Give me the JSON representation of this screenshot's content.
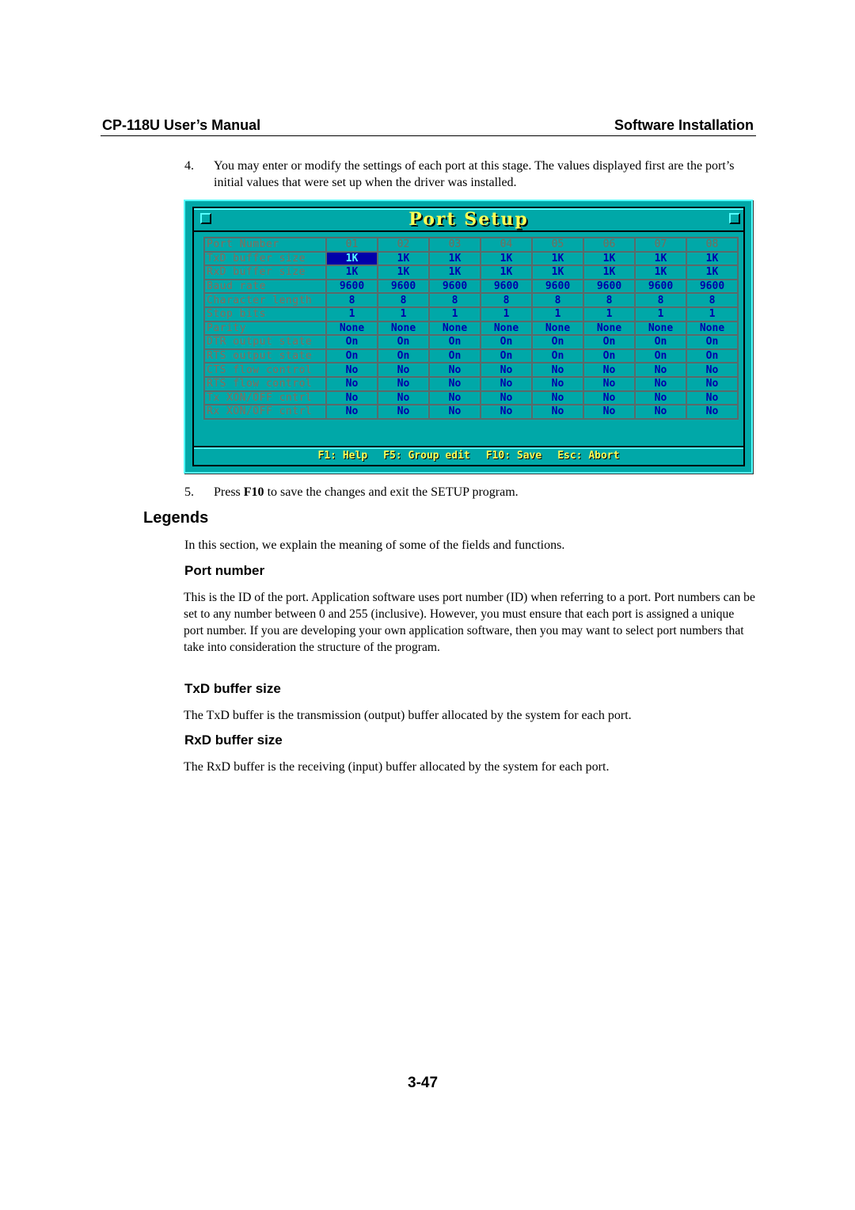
{
  "header": {
    "left": "CP-118U User’s Manual",
    "right": "Software Installation"
  },
  "steps": [
    {
      "num": "4.",
      "text": "You may enter or modify the settings of each port at this stage. The values displayed first are the port’s initial values that were set up when the driver was installed."
    },
    {
      "num": "5.",
      "pre": "Press ",
      "bold": "F10",
      "post": " to save the changes and exit the SETUP program."
    }
  ],
  "dos_window": {
    "title": "Port Setup",
    "colors": {
      "background": "#00a8a8",
      "highlight": "#55ffff",
      "title": "#ffff55",
      "value": "#0000aa",
      "label": "#8a6a5a",
      "selected_bg": "#0000aa"
    },
    "columns_label": "Port Number",
    "ports": [
      "01",
      "02",
      "03",
      "04",
      "05",
      "06",
      "07",
      "08"
    ],
    "selected_cell": {
      "row": "TxD buffer size",
      "port": "01"
    },
    "rows": [
      {
        "label": "TxD buffer size",
        "values": [
          "1K",
          "1K",
          "1K",
          "1K",
          "1K",
          "1K",
          "1K",
          "1K"
        ]
      },
      {
        "label": "RxD buffer size",
        "values": [
          "1K",
          "1K",
          "1K",
          "1K",
          "1K",
          "1K",
          "1K",
          "1K"
        ]
      },
      {
        "label": "Baud rate",
        "values": [
          "9600",
          "9600",
          "9600",
          "9600",
          "9600",
          "9600",
          "9600",
          "9600"
        ]
      },
      {
        "label": "Character length",
        "values": [
          "8",
          "8",
          "8",
          "8",
          "8",
          "8",
          "8",
          "8"
        ]
      },
      {
        "label": "Stop bits",
        "values": [
          "1",
          "1",
          "1",
          "1",
          "1",
          "1",
          "1",
          "1"
        ]
      },
      {
        "label": "Parity",
        "values": [
          "None",
          "None",
          "None",
          "None",
          "None",
          "None",
          "None",
          "None"
        ]
      },
      {
        "label": "DTR output state",
        "values": [
          "On",
          "On",
          "On",
          "On",
          "On",
          "On",
          "On",
          "On"
        ]
      },
      {
        "label": "RTS output state",
        "values": [
          "On",
          "On",
          "On",
          "On",
          "On",
          "On",
          "On",
          "On"
        ]
      },
      {
        "label": "CTS flow control",
        "values": [
          "No",
          "No",
          "No",
          "No",
          "No",
          "No",
          "No",
          "No"
        ]
      },
      {
        "label": "RTS flow control",
        "values": [
          "No",
          "No",
          "No",
          "No",
          "No",
          "No",
          "No",
          "No"
        ]
      },
      {
        "label": "Tx XON/OFF cntrl",
        "values": [
          "No",
          "No",
          "No",
          "No",
          "No",
          "No",
          "No",
          "No"
        ]
      },
      {
        "label": "Rx XON/OFF cntrl",
        "values": [
          "No",
          "No",
          "No",
          "No",
          "No",
          "No",
          "No",
          "No"
        ]
      }
    ],
    "function_keys": [
      "F1: Help",
      "F5: Group edit",
      "F10: Save",
      "Esc: Abort"
    ]
  },
  "legends": {
    "title": "Legends",
    "intro": "In this section, we explain the meaning of some of the fields and functions.",
    "sections": [
      {
        "title": "Port number",
        "text": "This is the ID of the port. Application software uses port number (ID) when referring to a port. Port numbers can be set to any number between 0 and 255 (inclusive). However, you must ensure that each port is assigned a unique port number. If you are developing your own application software, then you may want to select port numbers that take into consideration the structure of the program."
      },
      {
        "title": "TxD buffer size",
        "text": "The TxD buffer is the transmission (output) buffer allocated by the system for each port."
      },
      {
        "title": "RxD buffer size",
        "text": "The RxD buffer is the receiving (input) buffer allocated by the system for each port."
      }
    ]
  },
  "page_number": "3-47"
}
